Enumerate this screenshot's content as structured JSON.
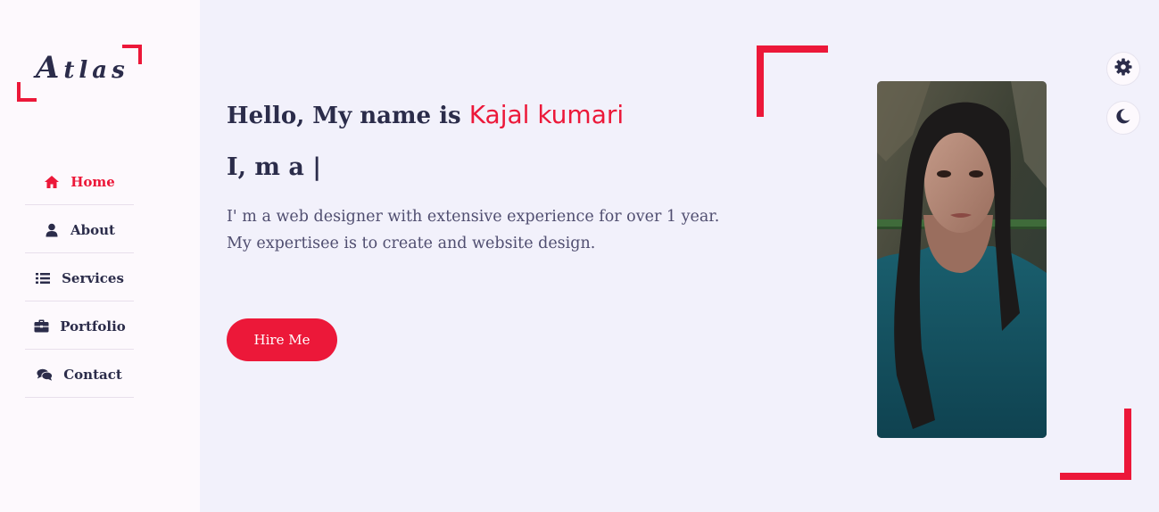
{
  "logo": {
    "first_letter": "A",
    "rest": "tlas"
  },
  "nav": [
    {
      "label": "Home",
      "icon": "home-icon",
      "active": true
    },
    {
      "label": "About",
      "icon": "user-icon",
      "active": false
    },
    {
      "label": "Services",
      "icon": "list-icon",
      "active": false
    },
    {
      "label": "Portfolio",
      "icon": "briefcase-icon",
      "active": false
    },
    {
      "label": "Contact",
      "icon": "comments-icon",
      "active": false
    }
  ],
  "hero": {
    "greeting": "Hello, My name is",
    "name": "Kajal kumari",
    "role": "I, m a |",
    "description": "I' m a web designer with extensive experience for over 1 year. My expertisee is to create and website design.",
    "hire_label": "Hire Me"
  },
  "toolbar": {
    "settings_icon": "gear-icon",
    "theme_icon": "moon-icon"
  },
  "colors": {
    "accent": "#ec1839",
    "text": "#2b2c4a",
    "bg": "#f2f1fb",
    "sidebar_bg": "#fdf9fd"
  }
}
